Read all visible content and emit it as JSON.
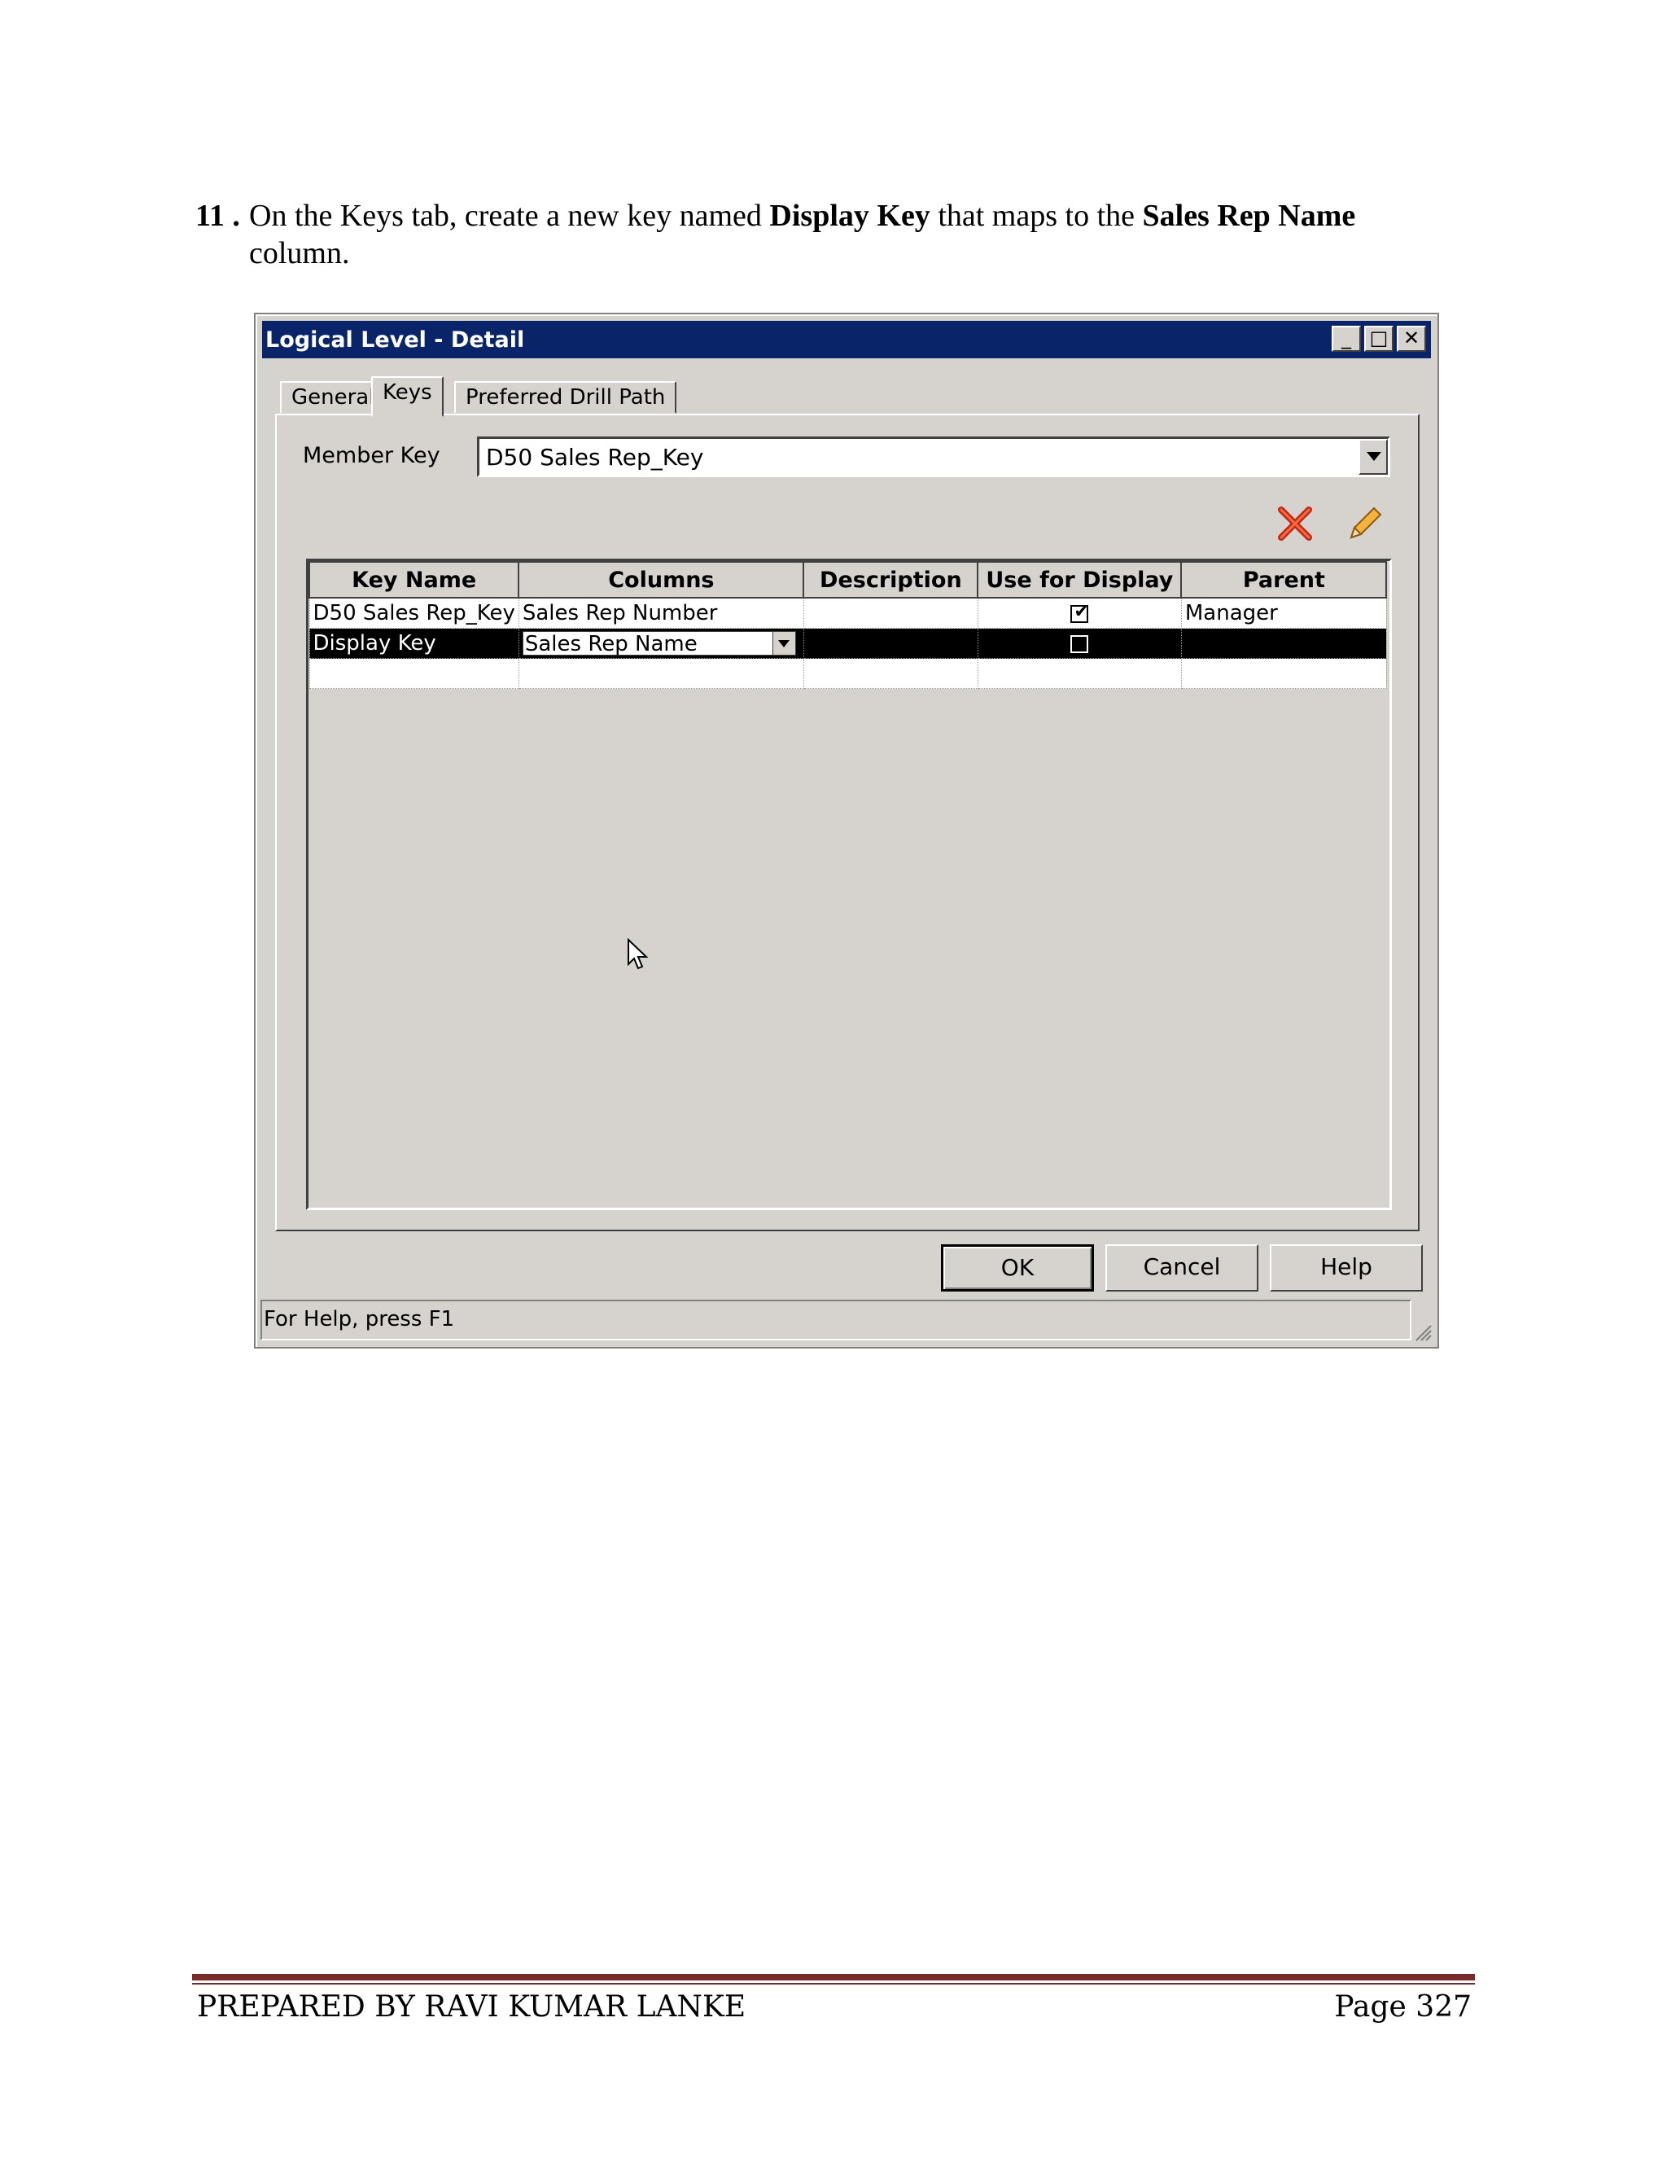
{
  "instruction": {
    "number": "11 .",
    "part1": "On the Keys tab, create a new key named ",
    "bold1": "Display Key",
    "part2": " that maps to the ",
    "bold2": "Sales Rep Name",
    "part3": " column."
  },
  "dialog": {
    "title": "Logical Level - Detail",
    "tabs": [
      "General",
      "Keys",
      "Preferred Drill Path"
    ],
    "member_key_label": "Member Key",
    "member_key_value": "D50 Sales Rep_Key",
    "icons": [
      "delete-icon",
      "edit-icon"
    ],
    "columns": [
      "Key Name",
      "Columns",
      "Description",
      "Use for Display",
      "Parent"
    ],
    "rows": [
      {
        "key_name": "D50 Sales Rep_Key",
        "columns": "Sales Rep Number",
        "description": "",
        "use_for_display": true,
        "parent": "Manager"
      },
      {
        "key_name": "Display Key",
        "columns": "Sales Rep Name",
        "description": "",
        "use_for_display": false,
        "parent": ""
      }
    ],
    "buttons": {
      "ok": "OK",
      "cancel": "Cancel",
      "help": "Help"
    },
    "status": "For Help, press F1"
  },
  "footer": {
    "left": "PREPARED BY RAVI KUMAR LANKE",
    "right": "Page 327"
  }
}
